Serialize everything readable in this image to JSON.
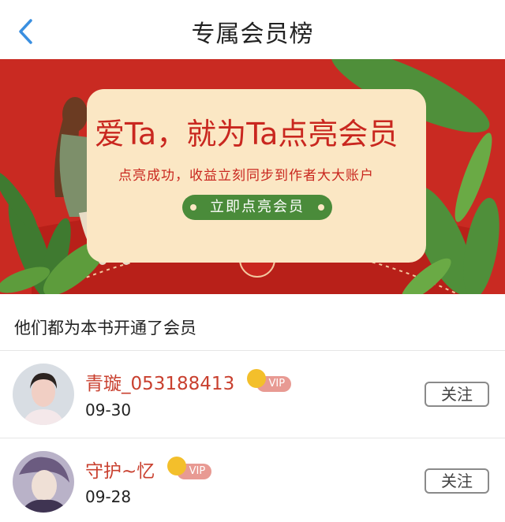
{
  "header": {
    "title": "专属会员榜",
    "back_icon": "chevron-left-icon",
    "accent_color": "#3a8fe0"
  },
  "banner": {
    "slogan": "爱Ta，就为Ta点亮会员",
    "sub_slogan": "点亮成功，收益立刻同步到作者大大账户",
    "button_label": "立即点亮会员",
    "background_color": "#c92a22",
    "card_color": "#fbe7c4",
    "button_color": "#4a8b3a"
  },
  "section": {
    "title": "他们都为本书开通了会员"
  },
  "members": [
    {
      "name": "青璇_053188413",
      "badge": "VIP",
      "date": "09-30",
      "follow_label": "关注"
    },
    {
      "name": "守护~忆",
      "badge": "VIP",
      "date": "09-28",
      "follow_label": "关注"
    }
  ]
}
